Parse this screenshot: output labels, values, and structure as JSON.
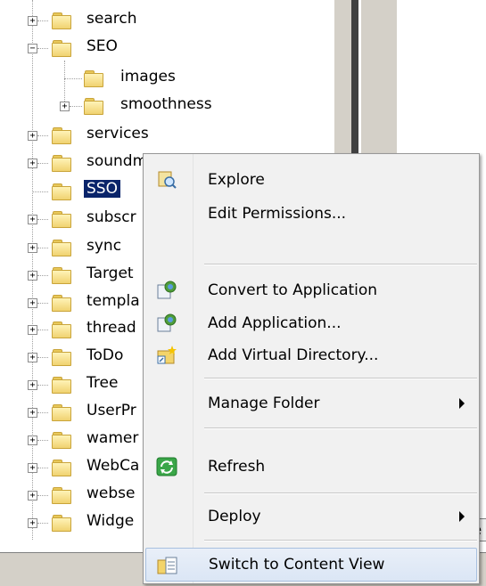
{
  "tree": {
    "items": [
      {
        "label": "search",
        "expander": "+"
      },
      {
        "label": "SEO",
        "expander": "−"
      },
      {
        "label": "images",
        "expander": ""
      },
      {
        "label": "smoothness",
        "expander": "+"
      },
      {
        "label": "services",
        "expander": "+"
      },
      {
        "label": "soundmanager",
        "expander": "+"
      },
      {
        "label": "SSO",
        "expander": ""
      },
      {
        "label": "subscr",
        "expander": "+"
      },
      {
        "label": "sync",
        "expander": "+"
      },
      {
        "label": "Target",
        "expander": "+"
      },
      {
        "label": "templa",
        "expander": "+"
      },
      {
        "label": "thread",
        "expander": "+"
      },
      {
        "label": "ToDo",
        "expander": "+"
      },
      {
        "label": "Tree",
        "expander": "+"
      },
      {
        "label": "UserPr",
        "expander": "+"
      },
      {
        "label": "wamer",
        "expander": "+"
      },
      {
        "label": "WebCa",
        "expander": "+"
      },
      {
        "label": "webse",
        "expander": "+"
      },
      {
        "label": "Widge",
        "expander": "+"
      }
    ],
    "selected": "SSO"
  },
  "right_pane": {
    "partial_button_text": "re"
  },
  "context_menu": {
    "items": [
      {
        "label": "Explore",
        "icon": "explore-icon"
      },
      {
        "label": "Edit Permissions...",
        "icon": ""
      },
      {
        "label": "Convert to Application",
        "icon": "convert-app-icon"
      },
      {
        "label": "Add Application...",
        "icon": "add-app-icon"
      },
      {
        "label": "Add Virtual Directory...",
        "icon": "add-vdir-icon"
      },
      {
        "label": "Manage Folder",
        "icon": "",
        "submenu": true
      },
      {
        "label": "Refresh",
        "icon": "refresh-icon"
      },
      {
        "label": "Deploy",
        "icon": "",
        "submenu": true
      },
      {
        "label": "Switch to Content View",
        "icon": "content-view-icon",
        "highlighted": true
      }
    ]
  },
  "colors": {
    "selection": "#0a246a",
    "menu_bg": "#f1f1f1",
    "folder": "#f0d270"
  }
}
